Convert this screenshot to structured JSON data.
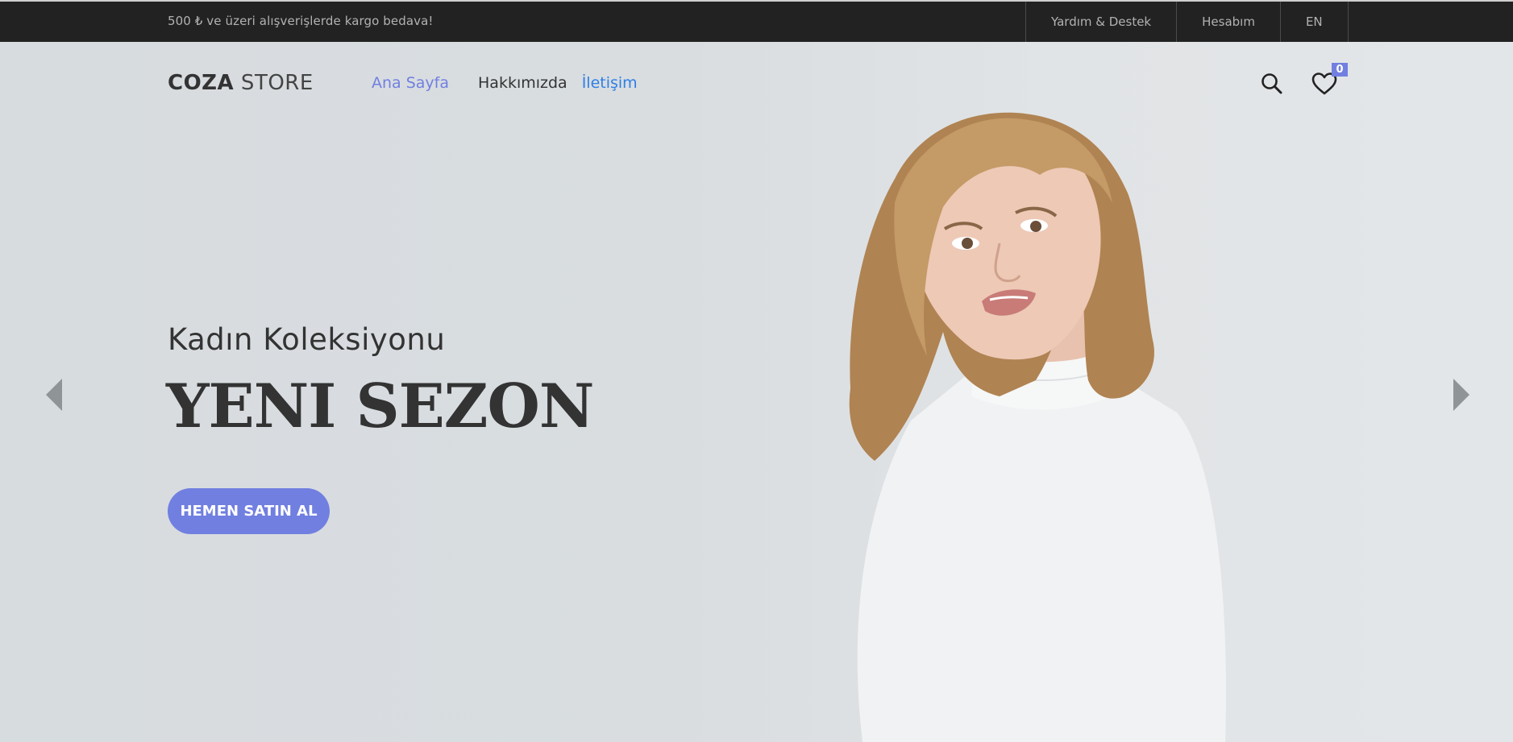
{
  "topbar": {
    "promo": "500 ₺ ve üzeri alışverişlerde kargo bedava!",
    "links": [
      "Yardım & Destek",
      "Hesabım",
      "EN"
    ]
  },
  "header": {
    "logo_bold": "COZA",
    "logo_light": " STORE",
    "nav": {
      "home": "Ana Sayfa",
      "about": "Hakkımızda",
      "contact": "İletişim"
    },
    "wishlist_count": "0",
    "icons": [
      "search-icon",
      "heart-icon"
    ]
  },
  "hero": {
    "subtitle": "Kadın Koleksiyonu",
    "headline": "YENI SEZON",
    "cta_label": "HEMEN SATIN AL",
    "icons": [
      "chevron-left-icon",
      "chevron-right-icon"
    ]
  },
  "colors": {
    "accent": "#717fe0",
    "topbar_bg": "#222222",
    "hero_bg": "#d9dde0",
    "link_blue": "#2f7fe5",
    "text_dark": "#333333"
  }
}
